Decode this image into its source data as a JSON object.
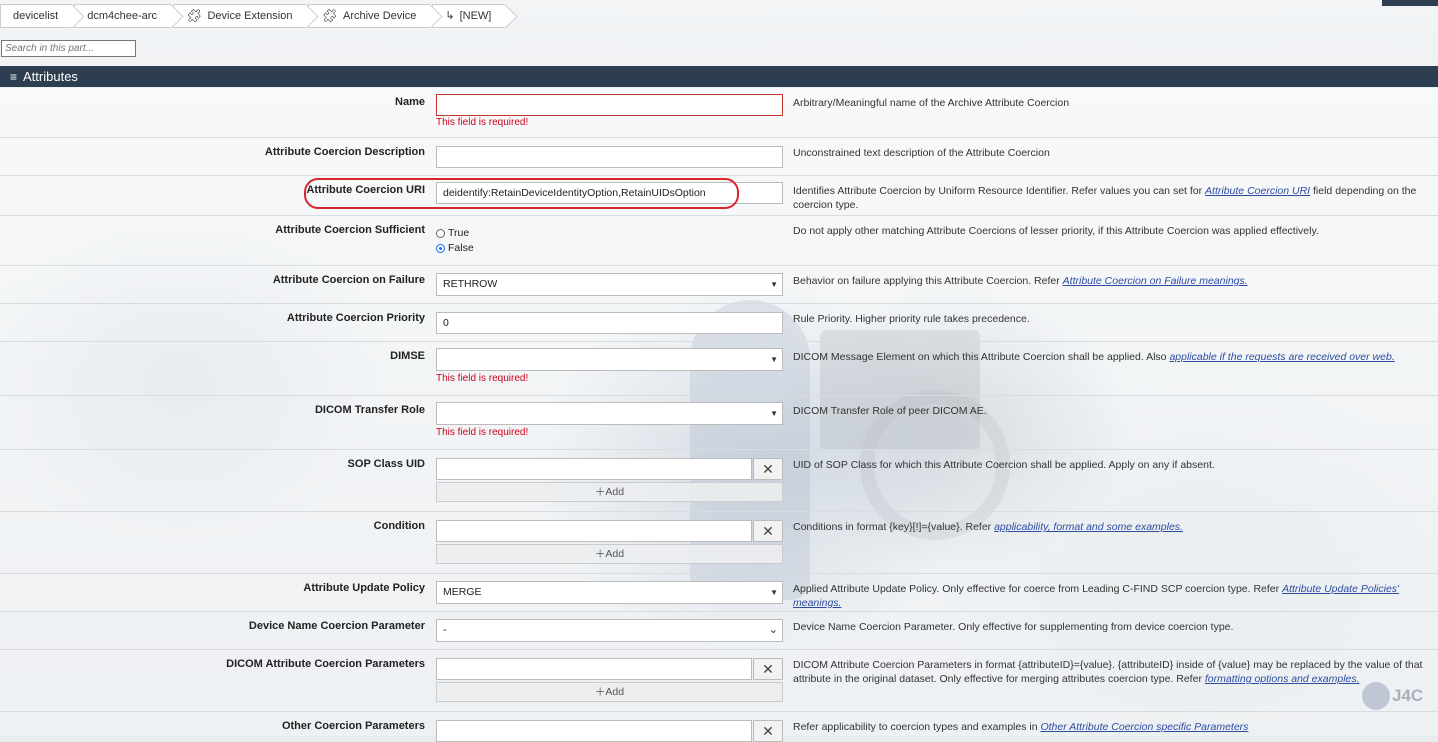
{
  "breadcrumb": [
    {
      "label": "devicelist",
      "icon": ""
    },
    {
      "label": "dcm4chee-arc",
      "icon": ""
    },
    {
      "label": "Device Extension",
      "icon": "puzzle-icon"
    },
    {
      "label": "Archive Device",
      "icon": "puzzle-icon"
    },
    {
      "label": "[NEW]",
      "icon": "return-arrow-icon"
    }
  ],
  "search": {
    "placeholder": "Search in this part..."
  },
  "header": {
    "icon": "≡",
    "title": "Attributes"
  },
  "required_msg": "This field is required!",
  "add_label": "Add",
  "fields": {
    "name": {
      "label": "Name",
      "value": "",
      "desc": "Arbitrary/Meaningful name of the Archive Attribute Coercion"
    },
    "description": {
      "label": "Attribute Coercion Description",
      "value": "",
      "desc": "Unconstrained text description of the Attribute Coercion"
    },
    "uri": {
      "label": "Attribute Coercion URI",
      "value": "deidentify:RetainDeviceIdentityOption,RetainUIDsOption",
      "desc": "Identifies Attribute Coercion by Uniform Resource Identifier. Refer values you can set for ",
      "link": "Attribute Coercion URI",
      "desc2": " field depending on the coercion type."
    },
    "sufficient": {
      "label": "Attribute Coercion Sufficient",
      "opt_true": "True",
      "opt_false": "False",
      "selected": "False",
      "desc": "Do not apply other matching Attribute Coercions of lesser priority, if this Attribute Coercion was applied effectively."
    },
    "on_failure": {
      "label": "Attribute Coercion on Failure",
      "value": "RETHROW",
      "desc": "Behavior on failure applying this Attribute Coercion. Refer ",
      "link": "Attribute Coercion on Failure meanings."
    },
    "priority": {
      "label": "Attribute Coercion Priority",
      "value": "0",
      "desc": "Rule Priority. Higher priority rule takes precedence."
    },
    "dimse": {
      "label": "DIMSE",
      "value": "",
      "desc": "DICOM Message Element on which this Attribute Coercion shall be applied. Also ",
      "link": "applicable if the requests are received over web."
    },
    "transfer_role": {
      "label": "DICOM Transfer Role",
      "value": "",
      "desc": "DICOM Transfer Role of peer DICOM AE."
    },
    "sop_class": {
      "label": "SOP Class UID",
      "desc": "UID of SOP Class for which this Attribute Coercion shall be applied. Apply on any if absent."
    },
    "condition": {
      "label": "Condition",
      "desc": "Conditions in format {key}[!]={value}. Refer ",
      "link": "applicability, format and some examples."
    },
    "update_policy": {
      "label": "Attribute Update Policy",
      "value": "MERGE",
      "desc": "Applied Attribute Update Policy. Only effective for coerce from Leading C-FIND SCP coercion type. Refer ",
      "link": "Attribute Update Policies' meanings."
    },
    "device_name_param": {
      "label": "Device Name Coercion Parameter",
      "value": "-",
      "desc": "Device Name Coercion Parameter. Only effective for supplementing from device coercion type."
    },
    "dicom_params": {
      "label": "DICOM Attribute Coercion Parameters",
      "desc": "DICOM Attribute Coercion Parameters in format {attributeID}={value}. {attributeID} inside of {value} may be replaced by the value of that attribute in the original dataset. Only effective for merging attributes coercion type. Refer ",
      "link": "formatting options and examples."
    },
    "other_params": {
      "label": "Other Coercion Parameters",
      "desc": "Refer applicability to coercion types and examples in ",
      "link": "Other Attribute Coercion specific Parameters"
    }
  },
  "logo_text": "J4C"
}
